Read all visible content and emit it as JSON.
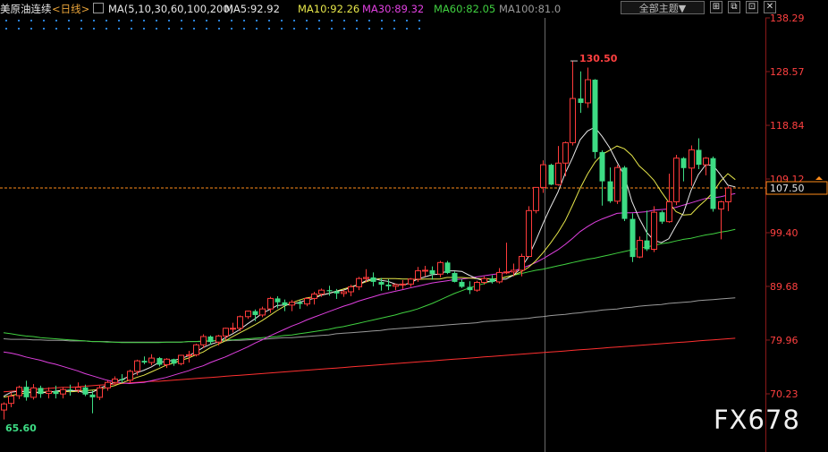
{
  "header": {
    "title": "美原油连续",
    "period": "<日线>",
    "ma_params": "MA(5,10,30,60,100,200)",
    "ma5": "MA5:92.92",
    "ma10": "MA10:92.26",
    "ma30": "MA30:89.32",
    "ma60": "MA60:82.05",
    "ma100": "MA100:81.0",
    "theme_button": "全部主题▼",
    "window_buttons": [
      "⊞",
      "⧉",
      "⊡",
      "✕"
    ]
  },
  "colors": {
    "up": "#ff3b3b",
    "down": "#3ddc84",
    "ma5": "#e8e8e8",
    "ma10": "#e6e64a",
    "ma30": "#e040e0",
    "ma60": "#40d040",
    "ma100": "#9a9a9a",
    "ma200": "#ff3030",
    "axis_text": "#ff4040",
    "current_price_line": "#ff8c1a"
  },
  "watermark": "FX678",
  "chart_data": {
    "type": "candlestick",
    "title": "美原油连续",
    "period": "日线",
    "ylim": [
      65.6,
      138.29
    ],
    "y_ticks": [
      "138.29",
      "128.57",
      "118.84",
      "109.12",
      "99.40",
      "89.68",
      "79.96",
      "70.23"
    ],
    "y_tick_values": [
      138.29,
      128.57,
      118.84,
      109.12,
      99.4,
      89.68,
      79.96,
      70.23
    ],
    "current_price": 107.5,
    "current_price_label": "107.50",
    "high_label": "130.50",
    "low_label": "65.60",
    "candles": [
      [
        67.3,
        68.7,
        65.6,
        68.4
      ],
      [
        68.5,
        70.5,
        67.8,
        69.8
      ],
      [
        69.9,
        71.7,
        69.3,
        71.4
      ],
      [
        71.5,
        72.6,
        69.0,
        69.6
      ],
      [
        69.6,
        72.0,
        69.2,
        71.3
      ],
      [
        71.3,
        71.7,
        69.5,
        70.2
      ],
      [
        70.3,
        71.4,
        69.4,
        70.7
      ],
      [
        70.7,
        71.7,
        69.4,
        70.2
      ],
      [
        70.2,
        71.4,
        69.4,
        71.0
      ],
      [
        71.0,
        71.9,
        69.9,
        70.9
      ],
      [
        70.9,
        72.3,
        70.4,
        71.4
      ],
      [
        71.4,
        71.9,
        69.8,
        70.1
      ],
      [
        70.1,
        70.8,
        66.7,
        69.6
      ],
      [
        69.6,
        71.7,
        69.1,
        71.3
      ],
      [
        71.3,
        72.6,
        70.8,
        72.3
      ],
      [
        72.3,
        73.4,
        72.1,
        72.9
      ],
      [
        72.9,
        73.8,
        72.2,
        72.7
      ],
      [
        72.7,
        74.6,
        72.3,
        74.3
      ],
      [
        74.3,
        76.4,
        73.6,
        76.2
      ],
      [
        76.2,
        77.0,
        75.6,
        75.9
      ],
      [
        75.9,
        77.4,
        75.4,
        76.7
      ],
      [
        76.7,
        76.9,
        75.2,
        75.5
      ],
      [
        75.5,
        76.7,
        74.9,
        76.5
      ],
      [
        76.5,
        76.6,
        75.3,
        75.7
      ],
      [
        75.7,
        77.3,
        75.4,
        77.2
      ],
      [
        77.2,
        78.0,
        75.9,
        77.3
      ],
      [
        77.3,
        79.3,
        77.0,
        79.1
      ],
      [
        79.1,
        81.0,
        78.5,
        80.6
      ],
      [
        80.6,
        80.8,
        79.1,
        79.6
      ],
      [
        79.6,
        80.9,
        79.0,
        80.7
      ],
      [
        80.7,
        82.2,
        79.9,
        82.1
      ],
      [
        82.1,
        83.1,
        81.3,
        82.1
      ],
      [
        82.1,
        84.4,
        81.6,
        84.2
      ],
      [
        84.2,
        85.3,
        83.8,
        85.2
      ],
      [
        85.2,
        85.5,
        83.4,
        84.5
      ],
      [
        84.5,
        86.0,
        84.1,
        85.6
      ],
      [
        85.6,
        87.8,
        84.9,
        87.5
      ],
      [
        87.5,
        87.9,
        85.7,
        86.8
      ],
      [
        86.8,
        87.3,
        85.2,
        86.3
      ],
      [
        86.3,
        87.2,
        85.2,
        86.8
      ],
      [
        86.8,
        87.2,
        85.6,
        86.5
      ],
      [
        86.5,
        87.7,
        86.1,
        87.5
      ],
      [
        87.5,
        88.7,
        86.4,
        88.3
      ],
      [
        88.3,
        89.3,
        87.8,
        89.0
      ],
      [
        89.0,
        89.8,
        88.0,
        88.8
      ],
      [
        88.8,
        89.2,
        87.4,
        88.4
      ],
      [
        88.4,
        89.0,
        87.8,
        88.7
      ],
      [
        88.7,
        90.0,
        87.9,
        89.6
      ],
      [
        89.6,
        91.4,
        89.0,
        91.1
      ],
      [
        91.1,
        92.8,
        90.4,
        91.3
      ],
      [
        91.3,
        92.2,
        89.7,
        90.5
      ],
      [
        90.5,
        91.2,
        88.9,
        90.0
      ],
      [
        90.0,
        91.0,
        89.0,
        89.7
      ],
      [
        89.7,
        90.2,
        89.0,
        90.0
      ],
      [
        90.0,
        90.8,
        89.2,
        90.1
      ],
      [
        90.1,
        91.2,
        89.6,
        91.0
      ],
      [
        91.0,
        93.2,
        90.5,
        92.5
      ],
      [
        92.5,
        93.4,
        91.5,
        92.6
      ],
      [
        92.6,
        93.3,
        90.9,
        91.9
      ],
      [
        91.9,
        94.3,
        91.3,
        94.0
      ],
      [
        94.0,
        94.3,
        91.9,
        92.1
      ],
      [
        92.1,
        92.4,
        90.4,
        90.5
      ],
      [
        90.5,
        91.0,
        89.4,
        89.6
      ],
      [
        89.6,
        90.6,
        88.3,
        89.0
      ],
      [
        89.0,
        90.7,
        88.7,
        90.4
      ],
      [
        90.4,
        91.5,
        90.0,
        91.1
      ],
      [
        91.1,
        91.7,
        90.2,
        90.5
      ],
      [
        90.5,
        93.0,
        90.2,
        92.2
      ],
      [
        92.2,
        97.6,
        91.9,
        92.3
      ],
      [
        92.3,
        93.8,
        91.5,
        92.6
      ],
      [
        92.6,
        95.6,
        91.5,
        95.1
      ],
      [
        95.1,
        104.2,
        95.0,
        103.4
      ],
      [
        103.4,
        107.6,
        102.9,
        107.6
      ],
      [
        107.6,
        112.5,
        106.6,
        111.7
      ],
      [
        111.7,
        111.9,
        108.0,
        108.1
      ],
      [
        108.1,
        115.1,
        107.9,
        112.0
      ],
      [
        112.0,
        115.9,
        109.6,
        115.7
      ],
      [
        115.7,
        130.5,
        115.2,
        123.7
      ],
      [
        123.7,
        128.6,
        121.1,
        122.9
      ],
      [
        122.9,
        129.3,
        122.0,
        127.1
      ],
      [
        127.1,
        127.2,
        112.8,
        114.0
      ],
      [
        114.0,
        114.3,
        104.3,
        108.7
      ],
      [
        108.7,
        111.2,
        104.8,
        105.1
      ],
      [
        105.1,
        111.7,
        104.6,
        111.2
      ],
      [
        111.2,
        111.5,
        101.5,
        101.9
      ],
      [
        101.9,
        102.9,
        94.1,
        95.0
      ],
      [
        95.0,
        98.7,
        94.8,
        98.0
      ],
      [
        98.0,
        103.4,
        96.1,
        96.4
      ],
      [
        96.4,
        104.2,
        95.9,
        103.1
      ],
      [
        103.1,
        103.4,
        101.0,
        101.4
      ],
      [
        101.4,
        110.1,
        101.2,
        105.0
      ],
      [
        105.0,
        113.5,
        104.4,
        112.9
      ],
      [
        112.9,
        113.1,
        108.7,
        111.1
      ],
      [
        111.1,
        115.2,
        107.9,
        114.4
      ],
      [
        114.4,
        116.5,
        110.9,
        111.7
      ],
      [
        111.7,
        113.1,
        109.8,
        112.9
      ],
      [
        112.9,
        113.2,
        103.2,
        103.7
      ],
      [
        103.7,
        105.2,
        98.2,
        105.0
      ],
      [
        105.0,
        107.8,
        103.3,
        107.5
      ]
    ],
    "ma5": [
      69.8,
      70.5,
      70.7,
      70.6,
      70.5,
      70.4,
      70.5,
      70.7,
      70.9,
      70.8,
      70.8,
      70.4,
      70.5,
      71.2,
      71.8,
      72.3,
      72.8,
      73.4,
      74.0,
      74.5,
      75.1,
      75.9,
      76.1,
      76.3,
      76.6,
      77.1,
      77.8,
      78.6,
      79.2,
      79.6,
      80.4,
      81.1,
      81.9,
      82.9,
      83.8,
      84.8,
      85.5,
      86.2,
      86.3,
      86.4,
      86.8,
      87.2,
      87.5,
      88.1,
      88.4,
      88.8,
      89.0,
      89.5,
      90.0,
      90.7,
      91.1,
      90.8,
      90.6,
      90.1,
      89.9,
      90.3,
      91.0,
      91.4,
      91.8,
      91.9,
      92.5,
      92.5,
      92.4,
      91.7,
      91.1,
      90.7,
      90.5,
      90.9,
      91.0,
      91.7,
      93.0,
      95.0,
      97.9,
      101.1,
      104.0,
      106.7,
      110.2,
      113.0,
      116.2,
      117.8,
      118.5,
      116.8,
      114.8,
      112.2,
      109.7,
      105.1,
      102.0,
      99.5,
      98.0,
      97.6,
      98.3,
      100.7,
      103.0,
      107.0,
      109.9,
      111.7,
      111.6,
      109.9,
      108.0,
      107.7
    ],
    "ma10": [
      69.6,
      69.9,
      70.2,
      70.4,
      70.5,
      70.5,
      70.6,
      70.6,
      70.7,
      70.6,
      70.7,
      70.8,
      70.9,
      71.0,
      71.4,
      71.7,
      72.2,
      72.7,
      73.2,
      73.6,
      74.2,
      74.8,
      75.4,
      75.8,
      76.3,
      76.7,
      77.3,
      77.8,
      78.6,
      79.2,
      79.8,
      80.6,
      81.3,
      82.0,
      82.7,
      83.5,
      84.4,
      85.3,
      86.1,
      86.7,
      87.2,
      87.6,
      87.8,
      88.1,
      88.4,
      88.8,
      89.2,
      89.6,
      90.0,
      90.5,
      90.9,
      91.1,
      91.1,
      91.1,
      91.0,
      91.0,
      90.9,
      91.0,
      91.0,
      91.0,
      91.3,
      91.3,
      91.3,
      91.2,
      91.1,
      91.1,
      91.0,
      91.1,
      91.4,
      91.7,
      92.3,
      93.1,
      94.3,
      95.8,
      97.5,
      99.4,
      101.6,
      104.4,
      107.4,
      110.0,
      112.1,
      113.6,
      114.3,
      115.1,
      114.6,
      113.4,
      111.5,
      110.3,
      108.9,
      106.8,
      104.9,
      103.2,
      102.6,
      102.7,
      104.1,
      105.3,
      106.7,
      108.7,
      110.1,
      109.0
    ],
    "ma30": [
      77.8,
      77.6,
      77.3,
      76.9,
      76.6,
      76.3,
      75.9,
      75.6,
      75.2,
      74.8,
      74.4,
      73.9,
      73.5,
      73.1,
      72.7,
      72.4,
      72.2,
      72.1,
      72.2,
      72.3,
      72.6,
      72.9,
      73.2,
      73.6,
      74.0,
      74.4,
      74.9,
      75.3,
      75.9,
      76.4,
      76.9,
      77.5,
      78.1,
      78.7,
      79.4,
      80.0,
      80.7,
      81.3,
      81.9,
      82.5,
      83.0,
      83.6,
      84.1,
      84.6,
      85.1,
      85.6,
      86.1,
      86.5,
      87.0,
      87.4,
      87.8,
      88.2,
      88.5,
      88.8,
      89.1,
      89.4,
      89.7,
      90.0,
      90.3,
      90.5,
      90.7,
      90.9,
      91.0,
      91.2,
      91.4,
      91.6,
      91.8,
      92.0,
      92.2,
      92.5,
      92.9,
      93.4,
      94.0,
      94.7,
      95.5,
      96.3,
      97.3,
      98.4,
      99.6,
      100.5,
      101.3,
      101.9,
      102.4,
      102.9,
      103.0,
      103.0,
      103.1,
      103.2,
      103.5,
      103.6,
      103.7,
      104.0,
      104.4,
      104.8,
      105.2,
      105.6,
      105.7,
      105.9,
      106.2,
      106.5
    ],
    "ma60": [
      81.3,
      81.1,
      80.9,
      80.7,
      80.6,
      80.4,
      80.3,
      80.2,
      80.1,
      80.0,
      79.9,
      79.8,
      79.7,
      79.7,
      79.6,
      79.6,
      79.5,
      79.5,
      79.5,
      79.5,
      79.5,
      79.5,
      79.6,
      79.6,
      79.6,
      79.7,
      79.7,
      79.8,
      79.8,
      79.9,
      80.0,
      80.0,
      80.1,
      80.2,
      80.3,
      80.4,
      80.5,
      80.6,
      80.8,
      80.9,
      81.1,
      81.3,
      81.5,
      81.7,
      81.9,
      82.2,
      82.4,
      82.7,
      83.0,
      83.3,
      83.6,
      83.9,
      84.2,
      84.5,
      84.9,
      85.2,
      85.6,
      86.1,
      86.6,
      87.2,
      87.8,
      88.4,
      88.9,
      89.4,
      89.8,
      90.2,
      90.6,
      91.0,
      91.4,
      91.7,
      92.0,
      92.3,
      92.6,
      92.8,
      93.1,
      93.4,
      93.7,
      94.0,
      94.3,
      94.6,
      94.8,
      95.1,
      95.4,
      95.7,
      96.0,
      96.3,
      96.6,
      96.8,
      97.1,
      97.4,
      97.6,
      97.9,
      98.2,
      98.4,
      98.7,
      99.0,
      99.2,
      99.5,
      99.7,
      100.0
    ],
    "ma100": [
      80.2,
      80.1,
      80.1,
      80.1,
      80.0,
      80.0,
      79.9,
      79.9,
      79.9,
      79.8,
      79.8,
      79.8,
      79.7,
      79.7,
      79.7,
      79.6,
      79.6,
      79.6,
      79.6,
      79.6,
      79.6,
      79.6,
      79.6,
      79.6,
      79.6,
      79.7,
      79.7,
      79.7,
      79.8,
      79.8,
      79.8,
      79.9,
      79.9,
      80.0,
      80.1,
      80.1,
      80.2,
      80.3,
      80.4,
      80.4,
      80.5,
      80.6,
      80.7,
      80.8,
      80.9,
      81.1,
      81.2,
      81.3,
      81.4,
      81.5,
      81.6,
      81.7,
      81.9,
      82.0,
      82.1,
      82.2,
      82.3,
      82.4,
      82.5,
      82.6,
      82.7,
      82.8,
      82.9,
      83.0,
      83.1,
      83.3,
      83.4,
      83.5,
      83.6,
      83.7,
      83.8,
      83.9,
      84.1,
      84.2,
      84.4,
      84.5,
      84.6,
      84.8,
      84.9,
      85.1,
      85.2,
      85.4,
      85.5,
      85.6,
      85.8,
      85.9,
      86.1,
      86.2,
      86.3,
      86.4,
      86.6,
      86.7,
      86.8,
      86.9,
      87.1,
      87.2,
      87.3,
      87.4,
      87.5,
      87.6
    ],
    "ma200": [
      70.6,
      70.7,
      70.8,
      70.9,
      71.0,
      71.1,
      71.2,
      71.3,
      71.4,
      71.4,
      71.5,
      71.6,
      71.7,
      71.8,
      71.9,
      72.0,
      72.1,
      72.2,
      72.3,
      72.4,
      72.5,
      72.5,
      72.6,
      72.7,
      72.8,
      72.9,
      73.0,
      73.1,
      73.2,
      73.3,
      73.4,
      73.5,
      73.6,
      73.7,
      73.8,
      73.9,
      74.0,
      74.1,
      74.2,
      74.3,
      74.4,
      74.5,
      74.6,
      74.7,
      74.8,
      74.9,
      75.0,
      75.1,
      75.2,
      75.3,
      75.4,
      75.5,
      75.6,
      75.7,
      75.8,
      75.9,
      76.0,
      76.1,
      76.2,
      76.3,
      76.4,
      76.5,
      76.6,
      76.7,
      76.8,
      76.9,
      77.0,
      77.1,
      77.2,
      77.3,
      77.4,
      77.5,
      77.6,
      77.7,
      77.8,
      77.9,
      78.0,
      78.1,
      78.2,
      78.3,
      78.4,
      78.5,
      78.6,
      78.7,
      78.8,
      78.9,
      79.0,
      79.1,
      79.2,
      79.3,
      79.4,
      79.5,
      79.6,
      79.7,
      79.8,
      79.9,
      80.0,
      80.1,
      80.2,
      80.3
    ]
  }
}
